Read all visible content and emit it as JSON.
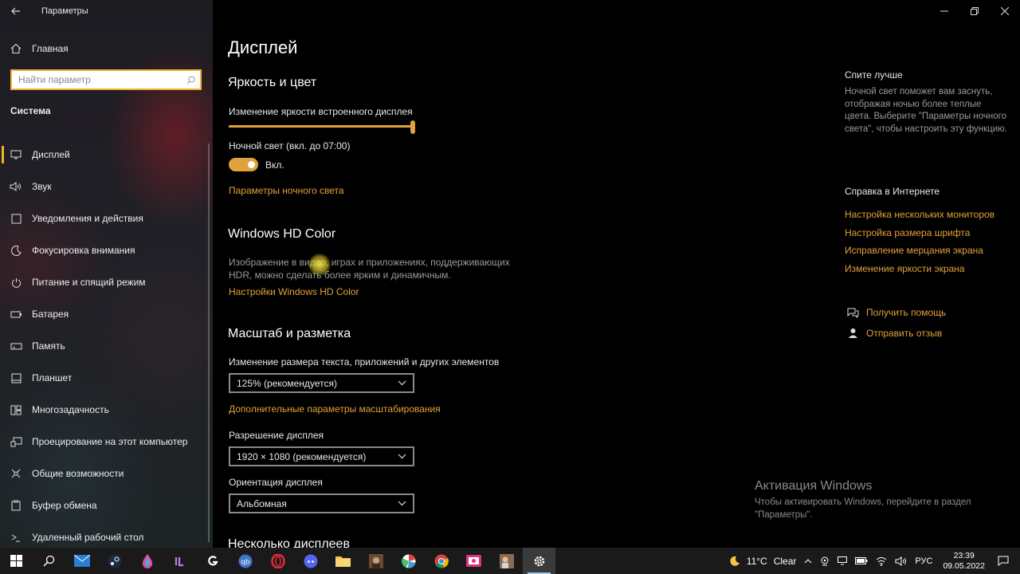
{
  "window": {
    "title": "Параметры"
  },
  "sidebar": {
    "home_label": "Главная",
    "search_placeholder": "Найти параметр",
    "section": "Система",
    "items": [
      {
        "label": "Дисплей",
        "icon": "monitor-icon",
        "active": true
      },
      {
        "label": "Звук",
        "icon": "speaker-icon"
      },
      {
        "label": "Уведомления и действия",
        "icon": "notification-icon"
      },
      {
        "label": "Фокусировка внимания",
        "icon": "moon-icon"
      },
      {
        "label": "Питание и спящий режим",
        "icon": "power-icon"
      },
      {
        "label": "Батарея",
        "icon": "battery-icon"
      },
      {
        "label": "Память",
        "icon": "storage-icon"
      },
      {
        "label": "Планшет",
        "icon": "tablet-icon"
      },
      {
        "label": "Многозадачность",
        "icon": "multitask-icon"
      },
      {
        "label": "Проецирование на этот компьютер",
        "icon": "project-icon"
      },
      {
        "label": "Общие возможности",
        "icon": "shared-icon"
      },
      {
        "label": "Буфер обмена",
        "icon": "clipboard-icon"
      },
      {
        "label": "Удаленный рабочий стол",
        "icon": "remote-desktop-icon"
      }
    ]
  },
  "main": {
    "title": "Дисплей",
    "brightness": {
      "heading": "Яркость и цвет",
      "slider_label": "Изменение яркости встроенного дисплея",
      "level_percent": 100,
      "night_light_label": "Ночной свет (вкл. до 07:00)",
      "toggle_on": true,
      "toggle_text": "Вкл.",
      "night_light_link": "Параметры ночного света"
    },
    "hdr": {
      "heading": "Windows HD Color",
      "desc_line1": "Изображение в видео, играх и приложениях, поддерживающих",
      "desc_line2": "HDR, можно сделать более ярким и динамичным.",
      "link": "Настройки Windows HD Color"
    },
    "scale": {
      "heading": "Масштаб и разметка",
      "size_label": "Изменение размера текста, приложений и других элементов",
      "size_value": "125% (рекомендуется)",
      "advanced_link": "Дополнительные параметры масштабирования",
      "resolution_label": "Разрешение дисплея",
      "resolution_value": "1920 × 1080 (рекомендуется)",
      "orientation_label": "Ориентация дисплея",
      "orientation_value": "Альбомная"
    },
    "next_heading": "Несколько дисплеев"
  },
  "right": {
    "sleep_title": "Спите лучше",
    "sleep_desc": "Ночной свет поможет вам заснуть, отображая ночью более теплые цвета. Выберите \"Параметры ночного света\", чтобы настроить эту функцию.",
    "help_title": "Справка в Интернете",
    "links": [
      "Настройка нескольких мониторов",
      "Настройка размера шрифта",
      "Исправление мерцания экрана",
      "Изменение яркости экрана"
    ],
    "get_help": "Получить помощь",
    "feedback": "Отправить отзыв"
  },
  "activation": {
    "title": "Активация Windows",
    "line1": "Чтобы активировать Windows, перейдите в раздел",
    "line2": "\"Параметры\"."
  },
  "taskbar": {
    "weather": "11°C",
    "weather_text": "Clear",
    "lang": "РУС",
    "time": "23:39",
    "date": "09.05.2022"
  },
  "colors": {
    "accent": "#e0a23a",
    "background": "#000000",
    "sidebar": "#1f1f24"
  }
}
